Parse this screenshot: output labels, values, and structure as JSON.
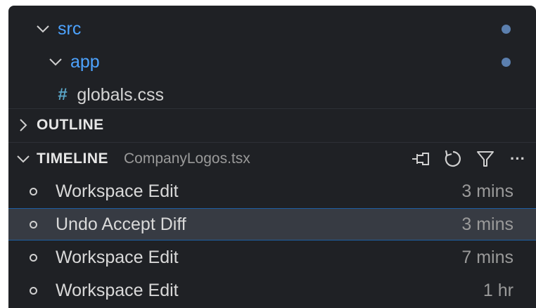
{
  "explorer": {
    "items": [
      {
        "label": "src",
        "type": "folder",
        "expanded": true,
        "modified": true
      },
      {
        "label": "app",
        "type": "folder",
        "expanded": true,
        "modified": true
      },
      {
        "label": "globals.css",
        "type": "file",
        "icon": "hash-icon"
      }
    ]
  },
  "outline": {
    "title": "OUTLINE",
    "expanded": false
  },
  "timeline": {
    "title": "TIMELINE",
    "file": "CompanyLogos.tsx",
    "expanded": true,
    "actions": [
      "pin-icon",
      "refresh-icon",
      "filter-icon",
      "more-icon"
    ],
    "more_label": "···",
    "entries": [
      {
        "label": "Workspace Edit",
        "time": "3 mins",
        "selected": false
      },
      {
        "label": "Undo Accept Diff",
        "time": "3 mins",
        "selected": true
      },
      {
        "label": "Workspace Edit",
        "time": "7 mins",
        "selected": false
      },
      {
        "label": "Workspace Edit",
        "time": "1 hr",
        "selected": false
      }
    ]
  },
  "colors": {
    "background": "#1f2125",
    "folder_text": "#4da3ff",
    "modified_dot": "#5b7fae",
    "selection_bg": "#373b43",
    "selection_border": "#1e5fa3"
  }
}
